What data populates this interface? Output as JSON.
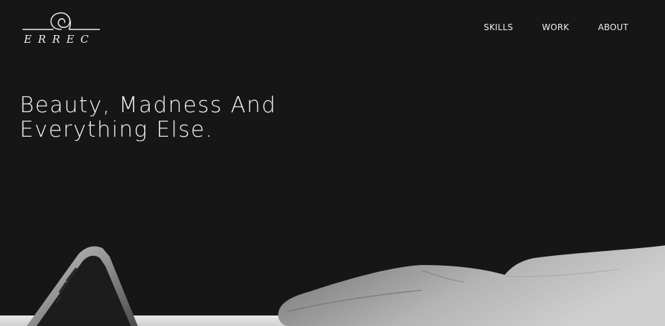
{
  "brand": {
    "logo_text": "ERREC",
    "logo_icon": "spiral-logo-icon"
  },
  "nav": {
    "items": [
      {
        "label": "SKILLS"
      },
      {
        "label": "WORK"
      },
      {
        "label": "ABOUT"
      }
    ]
  },
  "hero": {
    "title_line1": "Beauty, Madness And",
    "title_line2": "Everything Else."
  },
  "colors": {
    "background": "#161616",
    "text": "#f3f3f3"
  }
}
